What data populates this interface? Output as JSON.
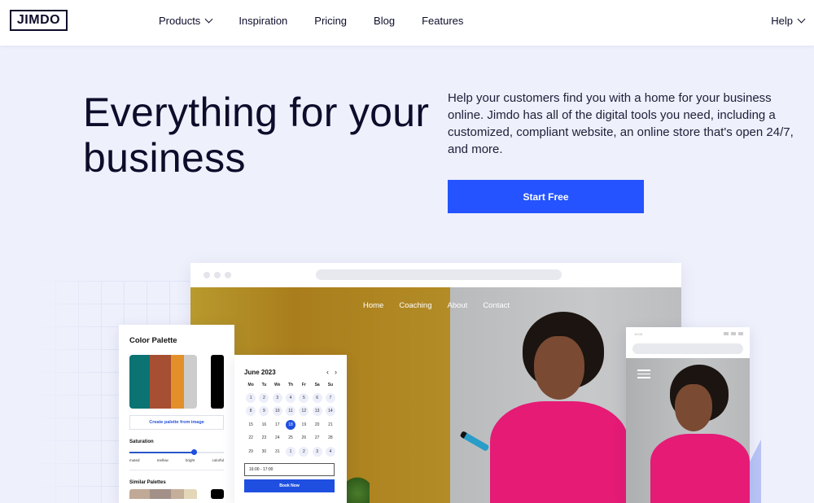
{
  "header": {
    "logo": "JIMDO",
    "nav": [
      {
        "label": "Products",
        "has_dropdown": true
      },
      {
        "label": "Inspiration",
        "has_dropdown": false
      },
      {
        "label": "Pricing",
        "has_dropdown": false
      },
      {
        "label": "Blog",
        "has_dropdown": false
      },
      {
        "label": "Features",
        "has_dropdown": false
      }
    ],
    "help": {
      "label": "Help",
      "has_dropdown": true
    }
  },
  "hero": {
    "title": "Everything for your business",
    "description": "Help your customers find you with a home for your business online. Jimdo has all of the digital tools you need, including a customized, compliant website, an online store that's open 24/7, and more.",
    "cta_label": "Start Free"
  },
  "colors": {
    "brand_blue": "#2453ff",
    "text_dark": "#0d0d2b",
    "background": "#eef0fc"
  },
  "browser_mockup": {
    "site_nav": [
      "Home",
      "Coaching",
      "About",
      "Contact"
    ]
  },
  "palette_card": {
    "title": "Color Palette",
    "swatches": [
      "#0b7372",
      "#a64f32",
      "#e38f2a",
      "#cccccc"
    ],
    "accent_swatch": "#000000",
    "create_button": "Create palette from image",
    "saturation_label": "Saturation",
    "saturation_level": 0.68,
    "saturation_scale": [
      "muted",
      "mellow",
      "bright",
      "colorful"
    ],
    "similar_label": "Similar Palettes",
    "similar_swatches": [
      "#c0a996",
      "#a39189",
      "#c5ae9a",
      "#e3d7b8"
    ],
    "similar_accent": "#000000"
  },
  "calendar_card": {
    "month": "June 2023",
    "prev_icon": "chevron-left-icon",
    "next_icon": "chevron-right-icon",
    "weekdays": [
      "Mo",
      "Tu",
      "We",
      "Th",
      "Fr",
      "Sa",
      "Su"
    ],
    "days": [
      {
        "d": "1",
        "s": "avail"
      },
      {
        "d": "2",
        "s": "avail"
      },
      {
        "d": "3",
        "s": "avail"
      },
      {
        "d": "4",
        "s": "avail"
      },
      {
        "d": "5",
        "s": "avail"
      },
      {
        "d": "6",
        "s": "avail"
      },
      {
        "d": "7",
        "s": "avail"
      },
      {
        "d": "8",
        "s": "avail"
      },
      {
        "d": "9",
        "s": "avail"
      },
      {
        "d": "10",
        "s": "avail"
      },
      {
        "d": "11",
        "s": "avail"
      },
      {
        "d": "12",
        "s": "avail"
      },
      {
        "d": "13",
        "s": "avail"
      },
      {
        "d": "14",
        "s": "avail"
      },
      {
        "d": "15",
        "s": ""
      },
      {
        "d": "16",
        "s": ""
      },
      {
        "d": "17",
        "s": ""
      },
      {
        "d": "18",
        "s": "sel"
      },
      {
        "d": "19",
        "s": ""
      },
      {
        "d": "20",
        "s": ""
      },
      {
        "d": "21",
        "s": ""
      },
      {
        "d": "22",
        "s": ""
      },
      {
        "d": "23",
        "s": ""
      },
      {
        "d": "24",
        "s": ""
      },
      {
        "d": "25",
        "s": ""
      },
      {
        "d": "26",
        "s": ""
      },
      {
        "d": "27",
        "s": ""
      },
      {
        "d": "28",
        "s": ""
      },
      {
        "d": "29",
        "s": ""
      },
      {
        "d": "30",
        "s": ""
      },
      {
        "d": "31",
        "s": ""
      },
      {
        "d": "1",
        "s": "avail"
      },
      {
        "d": "2",
        "s": "avail"
      },
      {
        "d": "3",
        "s": "avail"
      },
      {
        "d": "4",
        "s": "avail"
      }
    ],
    "selected_day": "18",
    "time_slot": "16:00 - 17:00",
    "book_button": "Book Now"
  },
  "mobile_mockup": {
    "status_time": "10:05",
    "menu_icon": "hamburger-menu-icon"
  }
}
